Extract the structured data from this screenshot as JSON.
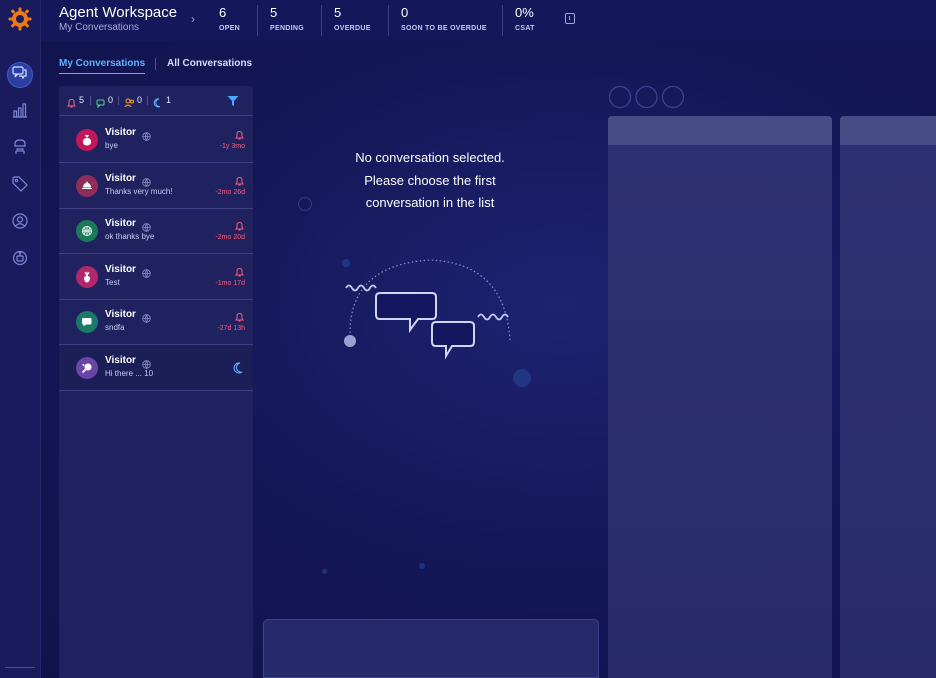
{
  "header": {
    "title": "Agent Workspace",
    "subtitle": "My Conversations",
    "stats": [
      {
        "value": "6",
        "label": "OPEN"
      },
      {
        "value": "5",
        "label": "PENDING"
      },
      {
        "value": "5",
        "label": "OVERDUE"
      },
      {
        "value": "0",
        "label": "SOON TO BE OVERDUE"
      },
      {
        "value": "0%",
        "label": "CSAT"
      }
    ]
  },
  "tabs": [
    {
      "label": "My Conversations",
      "active": true
    },
    {
      "label": "All Conversations",
      "active": false
    }
  ],
  "filters": {
    "alerts": "5",
    "chats": "0",
    "users": "0",
    "snoozed": "1"
  },
  "conversations": [
    {
      "name": "Visitor",
      "message": "bye",
      "time": "-1y 3mo",
      "avatar_color": "#c2185b",
      "icon": "money-bag-icon",
      "status": "alert"
    },
    {
      "name": "Visitor",
      "message": "Thanks very much!",
      "time": "-2mo 26d",
      "avatar_color": "#8e2c5a",
      "icon": "food-tray-icon",
      "status": "alert"
    },
    {
      "name": "Visitor",
      "message": "ok thanks bye",
      "time": "-2mo 20d",
      "avatar_color": "#1b7a5a",
      "icon": "basketball-icon",
      "status": "alert"
    },
    {
      "name": "Visitor",
      "message": "Test",
      "time": "-1mo 17d",
      "avatar_color": "#b0276b",
      "icon": "radish-icon",
      "status": "alert"
    },
    {
      "name": "Visitor",
      "message": "sndfa",
      "time": "-27d 13h",
      "avatar_color": "#1a7a68",
      "icon": "phone-bubble-icon",
      "status": "alert"
    },
    {
      "name": "Visitor",
      "message": "Hi there ... 10",
      "time": "",
      "avatar_color": "#6a45a8",
      "icon": "ping-pong-icon",
      "status": "snoozed"
    }
  ],
  "empty_state": {
    "line1": "No conversation selected.",
    "line2": "Please choose the first",
    "line3": "conversation in the list"
  },
  "colors": {
    "accent": "#5ab2ff",
    "alert": "#ff5a7a",
    "logo": "#f07a12"
  }
}
